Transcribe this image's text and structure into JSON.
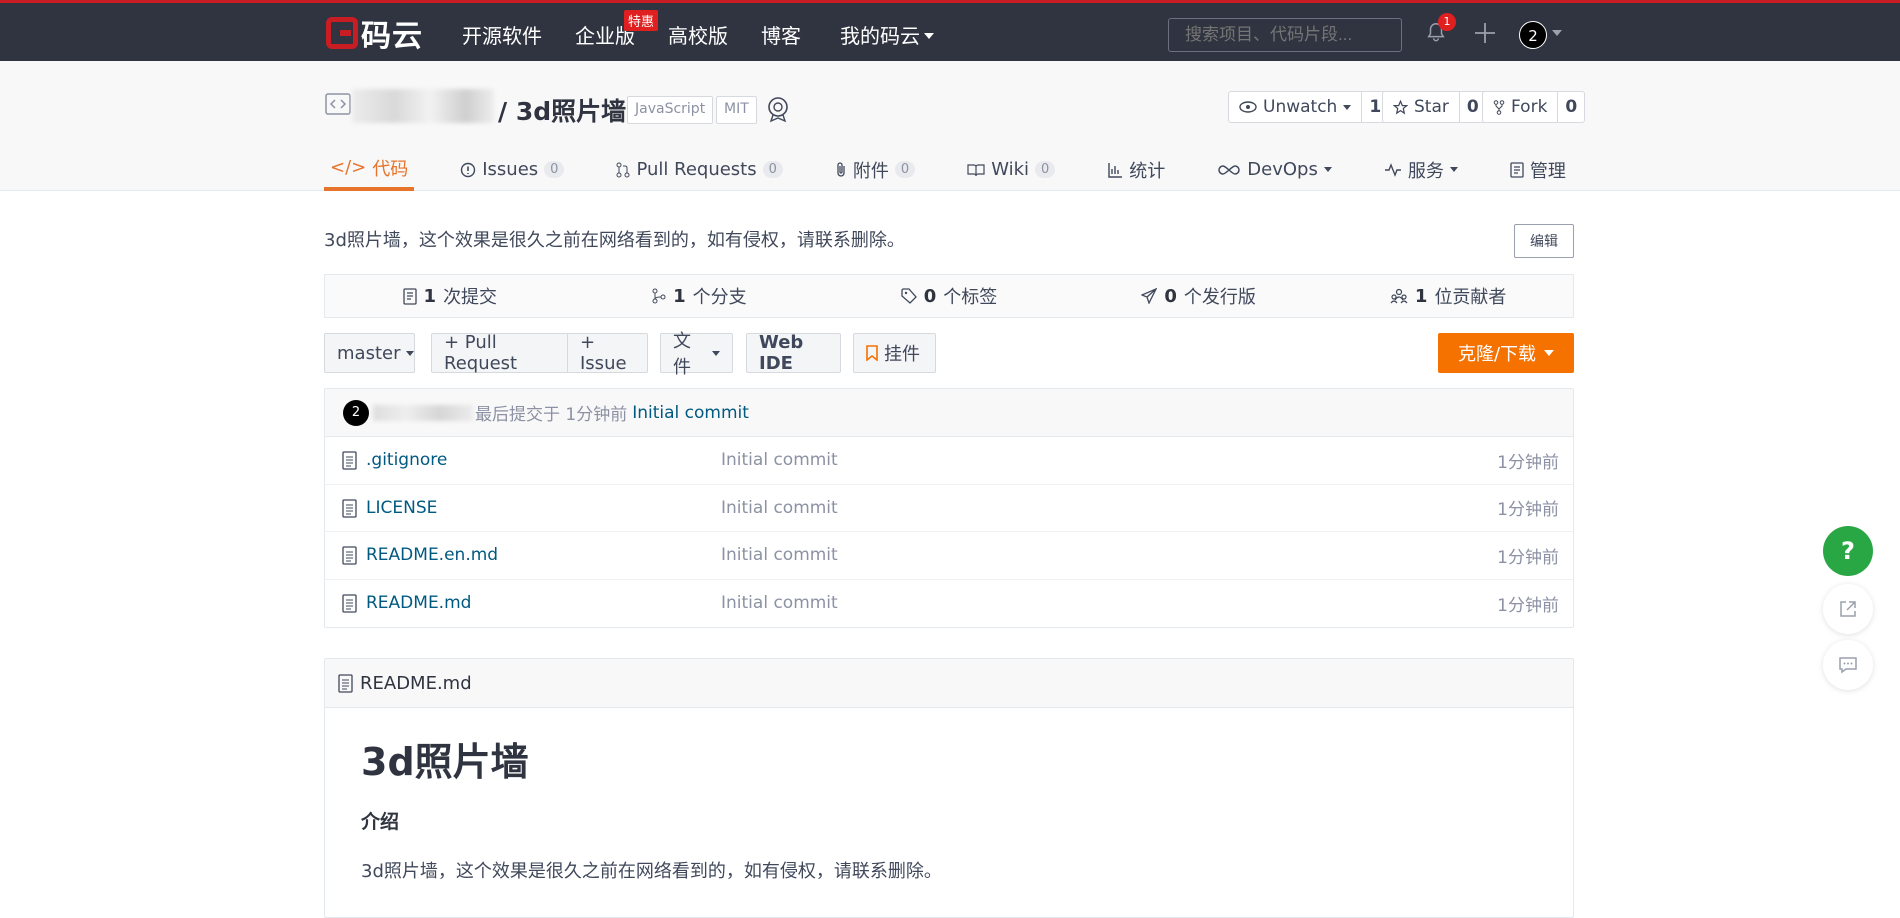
{
  "nav": {
    "logo_text": "码云",
    "items": [
      "开源软件",
      "企业版",
      "高校版",
      "博客",
      "我的码云"
    ],
    "badge": "特惠",
    "search_placeholder": "搜索项目、代码片段...",
    "notif_count": "1",
    "avatar_label": "2"
  },
  "repo": {
    "title": "/ 3d照片墙",
    "tags": [
      "JavaScript",
      "MIT"
    ],
    "actions": [
      {
        "label": "Unwatch",
        "count": "1"
      },
      {
        "label": "Star",
        "count": "0"
      },
      {
        "label": "Fork",
        "count": "0"
      }
    ],
    "tabs": [
      {
        "label": "代码",
        "count": ""
      },
      {
        "label": "Issues",
        "count": "0"
      },
      {
        "label": "Pull Requests",
        "count": "0"
      },
      {
        "label": "附件",
        "count": "0"
      },
      {
        "label": "Wiki",
        "count": "0"
      },
      {
        "label": "统计",
        "count": ""
      },
      {
        "label": "DevOps",
        "count": ""
      },
      {
        "label": "服务",
        "count": ""
      },
      {
        "label": "管理",
        "count": ""
      }
    ]
  },
  "description": "3d照片墙，这个效果是很久之前在网络看到的，如有侵权，请联系删除。",
  "edit_label": "编辑",
  "stats": [
    {
      "num": "1",
      "label": "次提交"
    },
    {
      "num": "1",
      "label": "个分支"
    },
    {
      "num": "0",
      "label": "个标签"
    },
    {
      "num": "0",
      "label": "个发行版"
    },
    {
      "num": "1",
      "label": "位贡献者"
    }
  ],
  "toolbar": {
    "branch": "master",
    "pull_request": "+ Pull Request",
    "issue": "+ Issue",
    "files": "文件",
    "web_ide": "Web IDE",
    "widget": "挂件",
    "clone": "克隆/下载"
  },
  "last_commit": {
    "avatar": "2",
    "text": "最后提交于 1分钟前",
    "message": "Initial commit"
  },
  "files": [
    {
      "name": ".gitignore",
      "message": "Initial commit",
      "time": "1分钟前"
    },
    {
      "name": "LICENSE",
      "message": "Initial commit",
      "time": "1分钟前"
    },
    {
      "name": "README.en.md",
      "message": "Initial commit",
      "time": "1分钟前"
    },
    {
      "name": "README.md",
      "message": "Initial commit",
      "time": "1分钟前"
    }
  ],
  "readme": {
    "filename": "README.md",
    "h1": "3d照片墙",
    "h3": "介绍",
    "p": "3d照片墙，这个效果是很久之前在网络看到的，如有侵权，请联系删除。"
  },
  "colors": {
    "nav_bg": "#2f3440",
    "brand_red": "#c71d23",
    "accent_orange": "#f57200",
    "link_blue": "#005980",
    "help_green": "#2aa745"
  }
}
